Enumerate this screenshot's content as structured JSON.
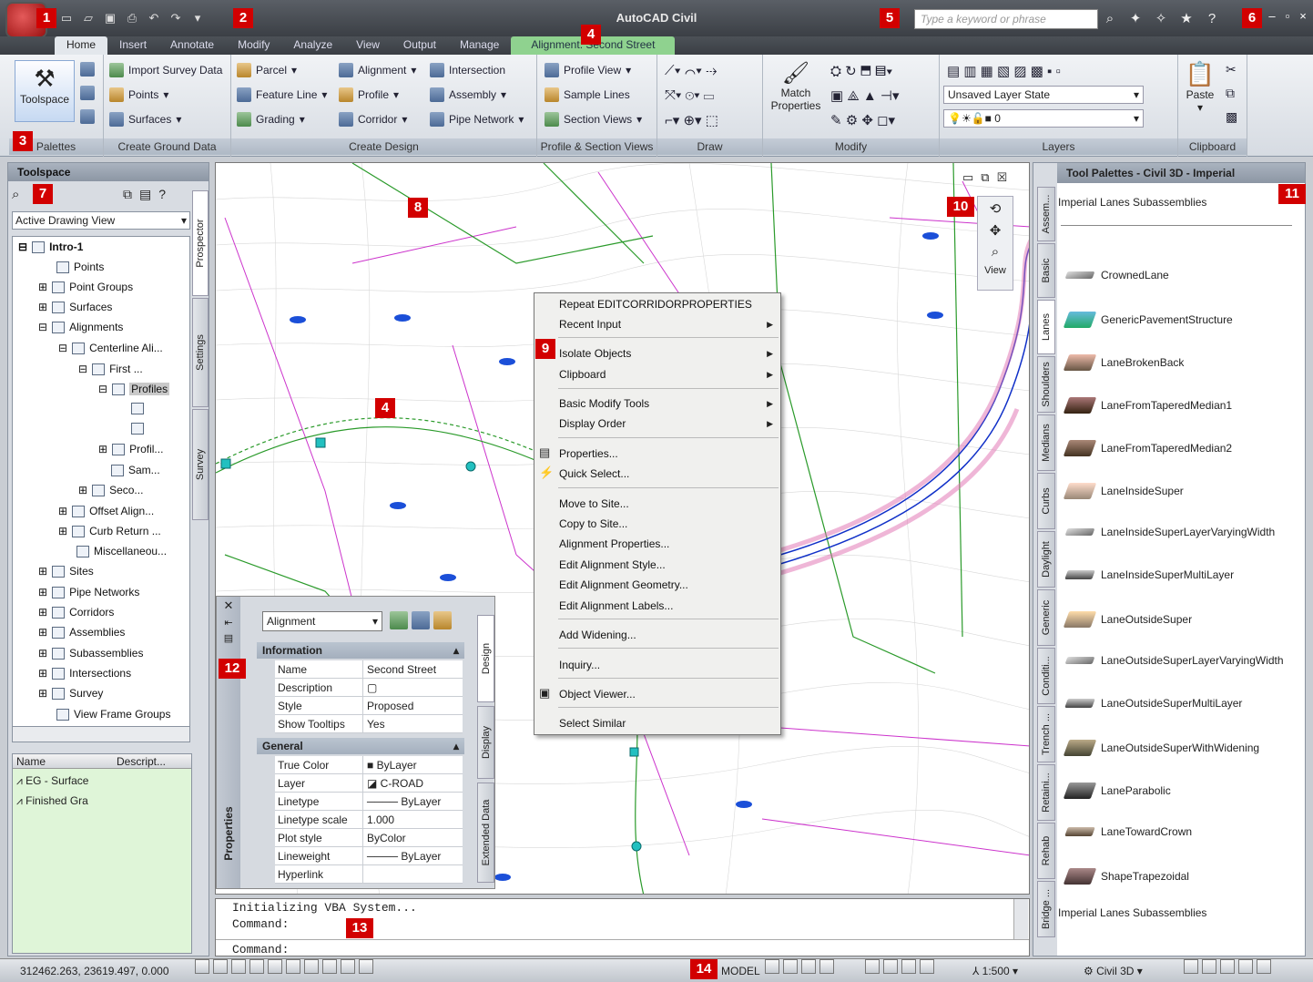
{
  "app": {
    "title": "AutoCAD Civil"
  },
  "search": {
    "placeholder": "Type a keyword or phrase"
  },
  "tabs": [
    {
      "label": "Home"
    },
    {
      "label": "Insert"
    },
    {
      "label": "Annotate"
    },
    {
      "label": "Modify"
    },
    {
      "label": "Analyze"
    },
    {
      "label": "View"
    },
    {
      "label": "Output"
    },
    {
      "label": "Manage"
    },
    {
      "label": "Alignment: Second Street"
    }
  ],
  "ribbon": {
    "palettes": {
      "toolspace": "Toolspace",
      "title": "Palettes"
    },
    "ground": {
      "items": [
        "Import Survey Data",
        "Points",
        "Surfaces"
      ],
      "title": "Create Ground Data"
    },
    "design": {
      "items": [
        "Parcel",
        "Feature Line",
        "Grading",
        "Alignment",
        "Profile",
        "Corridor",
        "Intersection",
        "Assembly",
        "Pipe Network"
      ],
      "title": "Create Design"
    },
    "profile": {
      "items": [
        "Profile View",
        "Sample Lines",
        "Section Views"
      ],
      "title": "Profile & Section Views"
    },
    "draw": {
      "title": "Draw"
    },
    "modify": {
      "match": "Match",
      "properties": "Properties",
      "title": "Modify"
    },
    "layers": {
      "state": "Unsaved Layer State",
      "layer": "0",
      "title": "Layers"
    },
    "clipboard": {
      "paste": "Paste",
      "title": "Clipboard"
    }
  },
  "toolspace": {
    "title": "Toolspace",
    "view": "Active Drawing View",
    "tree": [
      "Intro-1",
      "Points",
      "Point Groups",
      "Surfaces",
      "Alignments",
      "Centerline Ali...",
      "First ...",
      "Profiles",
      "Profil...",
      "Sam...",
      "Seco...",
      "Offset Align...",
      "Curb Return ...",
      "Miscellaneou...",
      "Sites",
      "Pipe Networks",
      "Corridors",
      "Assemblies",
      "Subassemblies",
      "Intersections",
      "Survey",
      "View Frame Groups"
    ],
    "tabs": [
      "Prospector",
      "Settings",
      "Survey"
    ],
    "list_headers": [
      "Name",
      "Descript..."
    ],
    "list_rows": [
      "EG - Surface",
      "Finished Gra"
    ]
  },
  "context_menu": {
    "items": [
      "Repeat EDITCORRIDORPROPERTIES",
      "Recent Input",
      "Isolate Objects",
      "Clipboard",
      "Basic Modify Tools",
      "Display Order",
      "Properties...",
      "Quick Select...",
      "Move to Site...",
      "Copy to Site...",
      "Alignment Properties...",
      "Edit Alignment Style...",
      "Edit Alignment Geometry...",
      "Edit Alignment Labels...",
      "Add Widening...",
      "Inquiry...",
      "Object Viewer...",
      "Select Similar"
    ]
  },
  "navbar": {
    "label": "View"
  },
  "properties": {
    "select": "Alignment",
    "title": "Properties",
    "sections": [
      "Information",
      "General"
    ],
    "info": [
      [
        "Name",
        "Second Street"
      ],
      [
        "Description",
        ""
      ],
      [
        "Style",
        "Proposed"
      ],
      [
        "Show Tooltips",
        "Yes"
      ]
    ],
    "general": [
      [
        "True Color",
        "ByLayer"
      ],
      [
        "Layer",
        "C-ROAD"
      ],
      [
        "Linetype",
        "ByLayer"
      ],
      [
        "Linetype scale",
        "1.000"
      ],
      [
        "Plot style",
        "ByColor"
      ],
      [
        "Lineweight",
        "ByLayer"
      ],
      [
        "Hyperlink",
        ""
      ]
    ],
    "side_tabs": [
      "Design",
      "Display",
      "Extended Data"
    ]
  },
  "palettes": {
    "title": "Tool Palettes - Civil 3D - Imperial",
    "group": "Imperial Lanes Subassemblies",
    "items": [
      "CrownedLane",
      "GenericPavementStructure",
      "LaneBrokenBack",
      "LaneFromTaperedMedian1",
      "LaneFromTaperedMedian2",
      "LaneInsideSuper",
      "LaneInsideSuperLayerVaryingWidth",
      "LaneInsideSuperMultiLayer",
      "LaneOutsideSuper",
      "LaneOutsideSuperLayerVaryingWidth",
      "LaneOutsideSuperMultiLayer",
      "LaneOutsideSuperWithWidening",
      "LaneParabolic",
      "LaneTowardCrown",
      "ShapeTrapezoidal"
    ],
    "footer": "Imperial Lanes Subassemblies",
    "tabs": [
      "Assem...",
      "Basic",
      "Lanes",
      "Shoulders",
      "Medians",
      "Curbs",
      "Daylight",
      "Generic",
      "Conditi...",
      "Trench ...",
      "Retaini...",
      "Rehab",
      "Bridge ..."
    ]
  },
  "command": {
    "line1": "Initializing VBA System...",
    "line2": "Command:",
    "line3": "Command:"
  },
  "status": {
    "coords": "312462.263, 23619.497, 0.000",
    "model": "MODEL",
    "scale": "1:500",
    "workspace": "Civil 3D"
  },
  "markers": [
    "1",
    "2",
    "3",
    "4",
    "4",
    "5",
    "6",
    "7",
    "8",
    "9",
    "10",
    "11",
    "12",
    "13",
    "14"
  ]
}
